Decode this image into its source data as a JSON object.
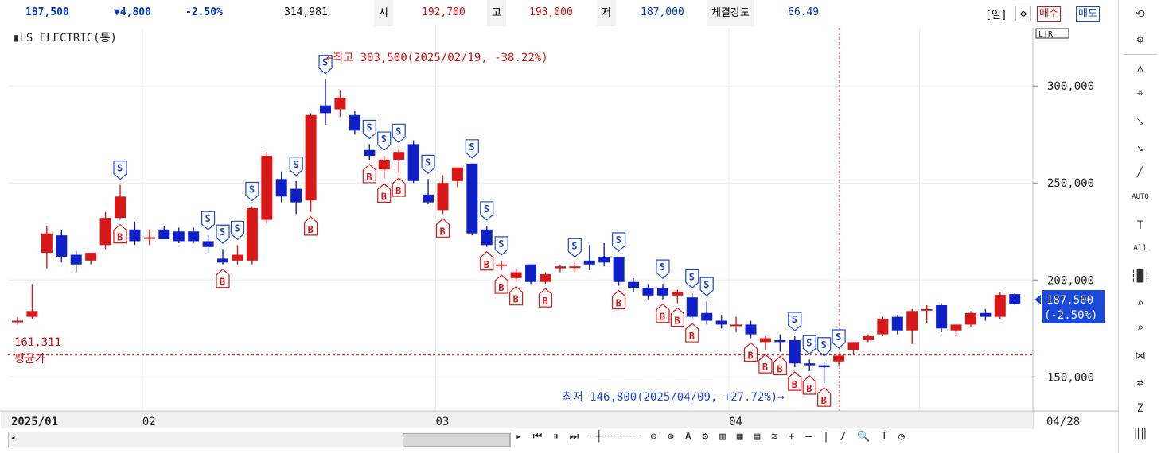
{
  "header": {
    "price": "187,500",
    "change": "▼4,800",
    "change_pct": "-2.50%",
    "volume": "314,981",
    "open_label": "시",
    "open": "192,700",
    "high_label": "고",
    "high": "193,000",
    "low_label": "저",
    "low": "187,000",
    "strength_label": "체결강도",
    "strength": "66.49",
    "period": "[일]",
    "buy_label": "매수",
    "sell_label": "매도"
  },
  "chart_labels": {
    "stock_name": "LS ELECTRIC(통)",
    "scale_mode": "L|R",
    "high_annotation": "←최고 303,500(2025/02/19, -38.22%)",
    "low_annotation": "최저 146,800(2025/04/09, +27.72%)→",
    "avg_value": "161,311",
    "avg_label": "평균가",
    "last_price": "187,500",
    "last_change": "(-2.50%)"
  },
  "chart_data": {
    "type": "candlestick",
    "title": "LS ELECTRIC(통)",
    "y_ticks": [
      150000,
      200000,
      250000,
      300000
    ],
    "y_tick_labels": [
      "150,000",
      "200,000",
      "250,000",
      "300,000"
    ],
    "ylim": [
      132500,
      330000
    ],
    "x_labels": [
      {
        "label": "2025/01",
        "index": 0
      },
      {
        "label": "02",
        "index": 9
      },
      {
        "label": "03",
        "index": 29
      },
      {
        "label": "04",
        "index": 49
      },
      {
        "label": "04/28",
        "index": 62
      }
    ],
    "average_price": 161311,
    "marker_index": 56,
    "candles": [
      {
        "o": 179000,
        "h": 181000,
        "l": 177000,
        "c": 179000
      },
      {
        "o": 181000,
        "h": 198000,
        "l": 180000,
        "c": 184000
      },
      {
        "o": 214000,
        "h": 228000,
        "l": 206000,
        "c": 224000
      },
      {
        "o": 223000,
        "h": 226000,
        "l": 209000,
        "c": 212000
      },
      {
        "o": 213000,
        "h": 215000,
        "l": 204000,
        "c": 208000
      },
      {
        "o": 210000,
        "h": 214000,
        "l": 208000,
        "c": 214000
      },
      {
        "o": 218000,
        "h": 235000,
        "l": 216000,
        "c": 232000
      },
      {
        "o": 232000,
        "h": 249000,
        "l": 231000,
        "c": 243000
      },
      {
        "o": 226000,
        "h": 230000,
        "l": 218000,
        "c": 220000
      },
      {
        "o": 222000,
        "h": 226000,
        "l": 218000,
        "c": 222000
      },
      {
        "o": 226000,
        "h": 228000,
        "l": 221000,
        "c": 221000
      },
      {
        "o": 225000,
        "h": 227000,
        "l": 219000,
        "c": 220000
      },
      {
        "o": 225000,
        "h": 227000,
        "l": 219000,
        "c": 220000
      },
      {
        "o": 220000,
        "h": 223000,
        "l": 214000,
        "c": 217000
      },
      {
        "o": 211000,
        "h": 216000,
        "l": 208000,
        "c": 209000
      },
      {
        "o": 210000,
        "h": 218000,
        "l": 208000,
        "c": 213000
      },
      {
        "o": 210000,
        "h": 238000,
        "l": 208000,
        "c": 237000
      },
      {
        "o": 231000,
        "h": 266000,
        "l": 229000,
        "c": 264000
      },
      {
        "o": 252000,
        "h": 256000,
        "l": 240000,
        "c": 243000
      },
      {
        "o": 247000,
        "h": 251000,
        "l": 234000,
        "c": 240000
      },
      {
        "o": 241000,
        "h": 286000,
        "l": 235000,
        "c": 285000
      },
      {
        "o": 290000,
        "h": 303500,
        "l": 280000,
        "c": 286000
      },
      {
        "o": 288000,
        "h": 298000,
        "l": 284000,
        "c": 294000
      },
      {
        "o": 285000,
        "h": 287000,
        "l": 275000,
        "c": 277000
      },
      {
        "o": 267000,
        "h": 270000,
        "l": 262000,
        "c": 264000
      },
      {
        "o": 257000,
        "h": 264000,
        "l": 252000,
        "c": 262000
      },
      {
        "o": 262000,
        "h": 268000,
        "l": 255000,
        "c": 266000
      },
      {
        "o": 270000,
        "h": 272000,
        "l": 250000,
        "c": 251000
      },
      {
        "o": 244000,
        "h": 252000,
        "l": 239000,
        "c": 240000
      },
      {
        "o": 236000,
        "h": 254000,
        "l": 234000,
        "c": 250000
      },
      {
        "o": 251000,
        "h": 258000,
        "l": 248000,
        "c": 258000
      },
      {
        "o": 260000,
        "h": 260000,
        "l": 223000,
        "c": 224000
      },
      {
        "o": 226000,
        "h": 228000,
        "l": 217000,
        "c": 218000
      },
      {
        "o": 208000,
        "h": 210000,
        "l": 205000,
        "c": 208000
      },
      {
        "o": 201000,
        "h": 206000,
        "l": 199000,
        "c": 204000
      },
      {
        "o": 208000,
        "h": 208000,
        "l": 198000,
        "c": 199000
      },
      {
        "o": 199000,
        "h": 204000,
        "l": 198000,
        "c": 203000
      },
      {
        "o": 206000,
        "h": 208000,
        "l": 204000,
        "c": 207000
      },
      {
        "o": 207000,
        "h": 209000,
        "l": 204000,
        "c": 207000
      },
      {
        "o": 210000,
        "h": 218000,
        "l": 205000,
        "c": 208000
      },
      {
        "o": 212000,
        "h": 219000,
        "l": 207000,
        "c": 209000
      },
      {
        "o": 212000,
        "h": 212000,
        "l": 197000,
        "c": 199000
      },
      {
        "o": 199000,
        "h": 201000,
        "l": 194000,
        "c": 196000
      },
      {
        "o": 196000,
        "h": 198000,
        "l": 190000,
        "c": 192000
      },
      {
        "o": 196000,
        "h": 198000,
        "l": 190000,
        "c": 192000
      },
      {
        "o": 192000,
        "h": 195000,
        "l": 188000,
        "c": 194000
      },
      {
        "o": 191000,
        "h": 193000,
        "l": 180000,
        "c": 181000
      },
      {
        "o": 183000,
        "h": 189000,
        "l": 177000,
        "c": 179000
      },
      {
        "o": 179000,
        "h": 182000,
        "l": 175000,
        "c": 177000
      },
      {
        "o": 177000,
        "h": 181000,
        "l": 173000,
        "c": 177000
      },
      {
        "o": 177000,
        "h": 179000,
        "l": 170000,
        "c": 172000
      },
      {
        "o": 168000,
        "h": 171000,
        "l": 164000,
        "c": 170000
      },
      {
        "o": 169000,
        "h": 172000,
        "l": 163000,
        "c": 168000
      },
      {
        "o": 169000,
        "h": 171000,
        "l": 155000,
        "c": 157000
      },
      {
        "o": 157000,
        "h": 159000,
        "l": 153000,
        "c": 156000
      },
      {
        "o": 156000,
        "h": 158000,
        "l": 146800,
        "c": 155000
      },
      {
        "o": 158000,
        "h": 162000,
        "l": 156000,
        "c": 161000
      },
      {
        "o": 164000,
        "h": 168000,
        "l": 162000,
        "c": 168000
      },
      {
        "o": 169000,
        "h": 172000,
        "l": 168000,
        "c": 171000
      },
      {
        "o": 172000,
        "h": 181000,
        "l": 171000,
        "c": 180000
      },
      {
        "o": 181000,
        "h": 182000,
        "l": 172000,
        "c": 174000
      },
      {
        "o": 174000,
        "h": 185000,
        "l": 167000,
        "c": 184000
      },
      {
        "o": 185000,
        "h": 187000,
        "l": 178000,
        "c": 185000
      },
      {
        "o": 187000,
        "h": 188000,
        "l": 173000,
        "c": 175000
      },
      {
        "o": 174000,
        "h": 177000,
        "l": 171000,
        "c": 177000
      },
      {
        "o": 177000,
        "h": 184000,
        "l": 176000,
        "c": 183000
      },
      {
        "o": 183000,
        "h": 185000,
        "l": 179000,
        "c": 181000
      },
      {
        "o": 181000,
        "h": 194000,
        "l": 180000,
        "c": 192300
      },
      {
        "o": 192700,
        "h": 193000,
        "l": 187000,
        "c": 187500
      }
    ],
    "signals_sell": [
      7,
      13,
      14,
      15,
      16,
      19,
      21,
      24,
      25,
      26,
      28,
      31,
      32,
      33,
      38,
      41,
      44,
      46,
      47,
      53,
      54,
      55,
      56
    ],
    "signals_buy": [
      7,
      14,
      20,
      24,
      25,
      26,
      29,
      32,
      33,
      34,
      36,
      41,
      44,
      45,
      46,
      50,
      51,
      52,
      53,
      54,
      55
    ]
  },
  "toolbar": {
    "icons": [
      "refresh-icon",
      "settings-icon",
      "indicator-icon",
      "crosshair-icon",
      "trend-icon",
      "line-icon",
      "diagonal-icon",
      "auto-icon",
      "text-icon",
      "all-icon",
      "candle-icon",
      "zoom-in-icon",
      "zoom-list-icon",
      "pattern-icon",
      "arrange-icon",
      "z-icon",
      "bars-icon"
    ],
    "auto_label": "AUTO",
    "text_label": "T",
    "all_label": "All"
  }
}
